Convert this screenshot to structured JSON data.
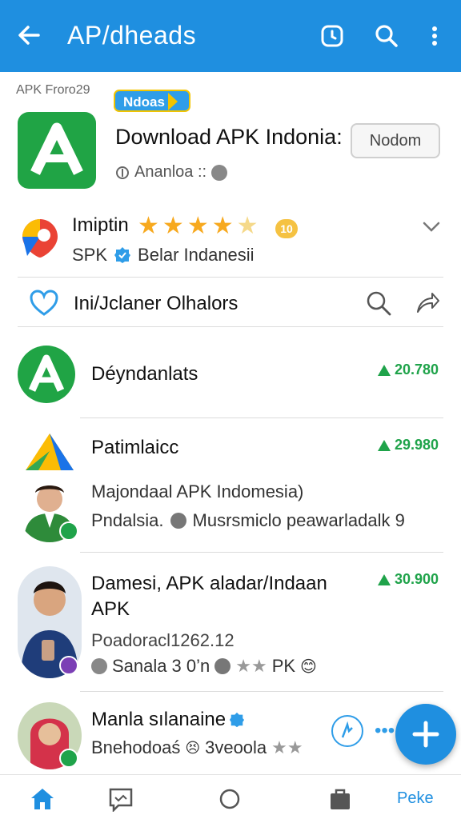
{
  "appbar": {
    "title": "AP/dheads",
    "back_icon": "arrow-left-icon",
    "icons": [
      "history-icon",
      "search-icon",
      "more-vert-icon"
    ]
  },
  "header": {
    "sub_label": "APK Froro29",
    "badge": "Ndoas"
  },
  "app": {
    "title": "Download APK Indonia:",
    "developer": "Ananloa ::",
    "install_label": "Nodom"
  },
  "rating": {
    "name": "Imiptin",
    "stars": 4.5,
    "count_badge": "10",
    "sub_prefix": "SPK",
    "sub_text": "Belar Indanesii"
  },
  "actions": {
    "text": "Ini/Jclaner Olhalors"
  },
  "list": [
    {
      "title": "Déyndanlats",
      "price": "20.780",
      "avatar": "green-logo"
    },
    {
      "title": "Patimlaicc",
      "line1": "Majondaal APK Indomesia)",
      "line2": "Pndalsia.",
      "line3": "Musrsmiclo peawarladalk 9",
      "price": "29.980",
      "avatar": "man-photo"
    },
    {
      "title": "Damesi, APK aladar/Indaan",
      "title2": "APK",
      "line1": "Poadoracl1262.12",
      "line2": "Sanala",
      "line3": "3 0’n",
      "line4": "PK",
      "price": "30.900",
      "avatar": "man2-photo"
    },
    {
      "title": "Manla sılanaine",
      "line1": "Bnehodoaś",
      "line2": "3veoola",
      "avatar": "woman-photo"
    }
  ],
  "bottom_nav": {
    "items": [
      "home-icon",
      "message-icon",
      "circle-icon",
      "bag-icon"
    ],
    "label": "Peke"
  },
  "colors": {
    "primary": "#1f8fe0",
    "green": "#20a445",
    "star": "#f7a91f"
  }
}
